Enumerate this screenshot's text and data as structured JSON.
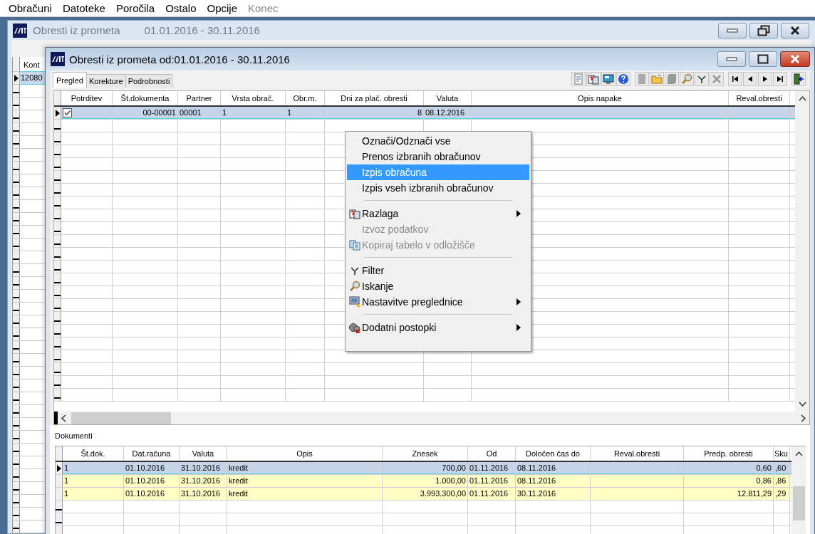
{
  "menu_bar": [
    {
      "label": "Obračuni",
      "disabled": false
    },
    {
      "label": "Datoteke",
      "disabled": false
    },
    {
      "label": "Poročila",
      "disabled": false
    },
    {
      "label": "Ostalo",
      "disabled": false
    },
    {
      "label": "Opcije",
      "disabled": false
    },
    {
      "label": "Konec",
      "disabled": true
    }
  ],
  "background_window": {
    "title": "Obresti iz prometa",
    "period": "01.01.2016 - 30.11.2016",
    "grid": {
      "columns": [
        "Kont"
      ],
      "rows": [
        {
          "selected": true,
          "cells": [
            "12080"
          ]
        }
      ]
    }
  },
  "window": {
    "title": "Obresti iz prometa od:01.01.2016 - 30.11.2016",
    "tabs": [
      {
        "label": "Pregled",
        "selected": true
      },
      {
        "label": "Korekture",
        "selected": false
      },
      {
        "label": "Podrobnosti",
        "selected": false
      }
    ],
    "grid": {
      "columns": [
        "Potrditev",
        "Št.dokumenta",
        "Partner",
        "Vrsta obrač.",
        "Obr.m.",
        "Dni za plač. obresti",
        "Valuta",
        "Opis napake",
        "Reval.obresti"
      ],
      "rows": [
        {
          "selected": true,
          "checked": true,
          "cells": [
            null,
            "00-00001",
            "00001",
            "1",
            "1",
            "8",
            "08.12.2016"
          ]
        }
      ]
    },
    "documents": {
      "label": "Dokumenti",
      "columns": [
        "Št.dok.",
        "Dat.računa",
        "Valuta",
        "Opis",
        "Znesek",
        "Od",
        "Določen čas do",
        "Reval.obresti",
        "Predp. obresti",
        "Sku"
      ],
      "rows": [
        {
          "selected": true,
          "cells": [
            "1",
            "01.10.2016",
            "31.10.2016",
            "kredit",
            "700,00",
            "01.11.2016",
            "08.11.2016",
            null,
            "0,60",
            ",60"
          ]
        },
        {
          "selected": false,
          "cells": [
            "1",
            "01.10.2016",
            "31.10.2016",
            "kredit",
            "1.000,00",
            "01.11.2016",
            "08.11.2016",
            null,
            "0,86",
            ",86"
          ]
        },
        {
          "selected": false,
          "cells": [
            "1",
            "01.10.2016",
            "31.10.2016",
            "kredit",
            "3.993.300,00",
            "01.11.2016",
            "30.11.2016",
            null,
            "12.811,29",
            ",29"
          ]
        }
      ]
    }
  },
  "context_menu": {
    "items": [
      {
        "kind": "item",
        "label": "Označi/Odznači vse",
        "selected": false,
        "disabled": false,
        "has_icon": false,
        "submenu": false
      },
      {
        "kind": "item",
        "label": "Prenos izbranih obračunov",
        "selected": false,
        "disabled": false,
        "has_icon": false,
        "submenu": false
      },
      {
        "kind": "item",
        "label": "Izpis obračuna",
        "selected": true,
        "disabled": false,
        "has_icon": false,
        "submenu": false
      },
      {
        "kind": "item",
        "label": "Izpis vseh izbranih obračunov",
        "selected": false,
        "disabled": false,
        "has_icon": false,
        "submenu": false
      },
      {
        "kind": "separator"
      },
      {
        "kind": "item",
        "label": "Razlaga",
        "selected": false,
        "disabled": false,
        "has_icon": true,
        "submenu": true
      },
      {
        "kind": "item",
        "label": "Izvoz podatkov",
        "selected": false,
        "disabled": true,
        "has_icon": false,
        "submenu": false
      },
      {
        "kind": "item",
        "label": "Kopiraj tabelo v odložišče",
        "selected": false,
        "disabled": true,
        "has_icon": true,
        "submenu": false
      },
      {
        "kind": "separator"
      },
      {
        "kind": "item",
        "label": "Filter",
        "selected": false,
        "disabled": false,
        "has_icon": true,
        "submenu": false
      },
      {
        "kind": "item",
        "label": "Iskanje",
        "selected": false,
        "disabled": false,
        "has_icon": true,
        "submenu": false
      },
      {
        "kind": "item",
        "label": "Nastavitve preglednice",
        "selected": false,
        "disabled": false,
        "has_icon": true,
        "submenu": true
      },
      {
        "kind": "separator"
      },
      {
        "kind": "item",
        "label": "Dodatni postopki",
        "selected": false,
        "disabled": false,
        "has_icon": true,
        "submenu": true
      }
    ]
  }
}
